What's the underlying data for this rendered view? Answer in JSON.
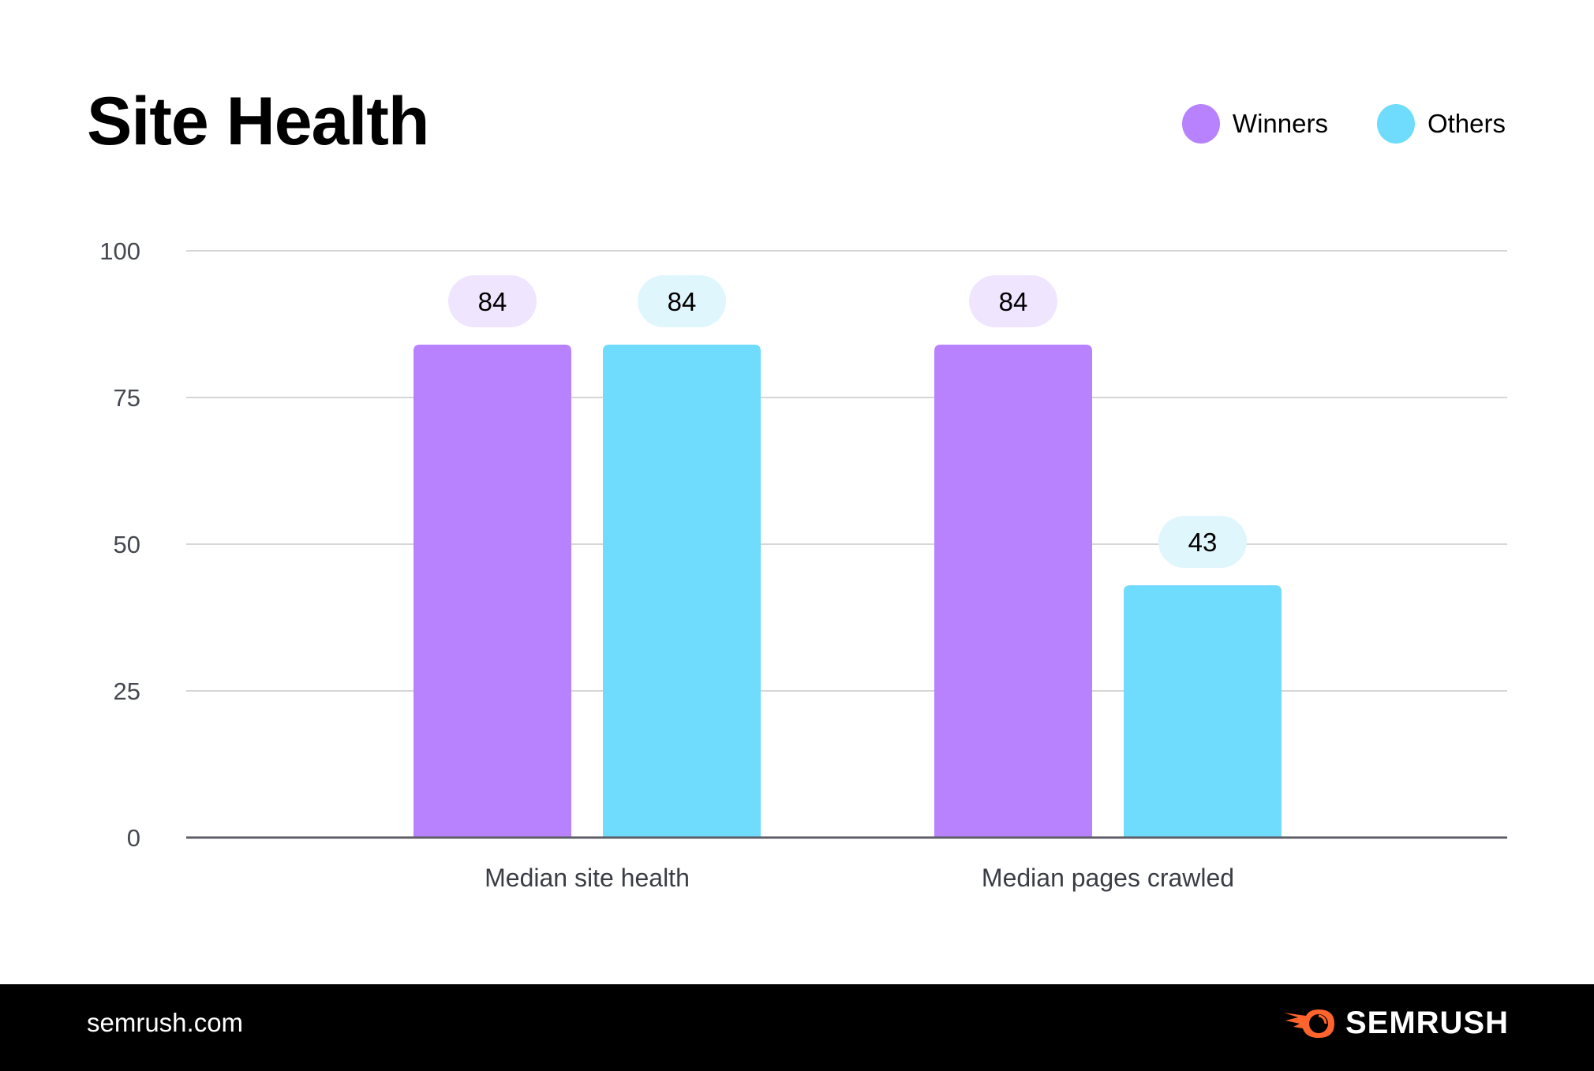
{
  "title": "Site Health",
  "legend": [
    {
      "label": "Winners",
      "color": "#b882ff"
    },
    {
      "label": "Others",
      "color": "#6fdbfd"
    }
  ],
  "colors": {
    "winners_bar": "#b882ff",
    "others_bar": "#6fdbfd",
    "winners_pill": "#f0e5ff",
    "others_pill": "#e0f6fd",
    "grid": "#d6d6d6",
    "axis": "#5c5d66"
  },
  "footer": {
    "url": "semrush.com",
    "brand": "SEMRUSH",
    "brand_color": "#ff642d"
  },
  "chart_data": {
    "type": "bar",
    "title": "Site Health",
    "categories": [
      "Median site health",
      "Median pages crawled"
    ],
    "series": [
      {
        "name": "Winners",
        "values": [
          84,
          84
        ]
      },
      {
        "name": "Others",
        "values": [
          84,
          43
        ]
      }
    ],
    "xlabel": "",
    "ylabel": "",
    "ylim": [
      0,
      100
    ],
    "yticks": [
      0,
      25,
      50,
      75,
      100
    ],
    "grid": true,
    "legend_position": "top-right",
    "data_labels": true
  }
}
